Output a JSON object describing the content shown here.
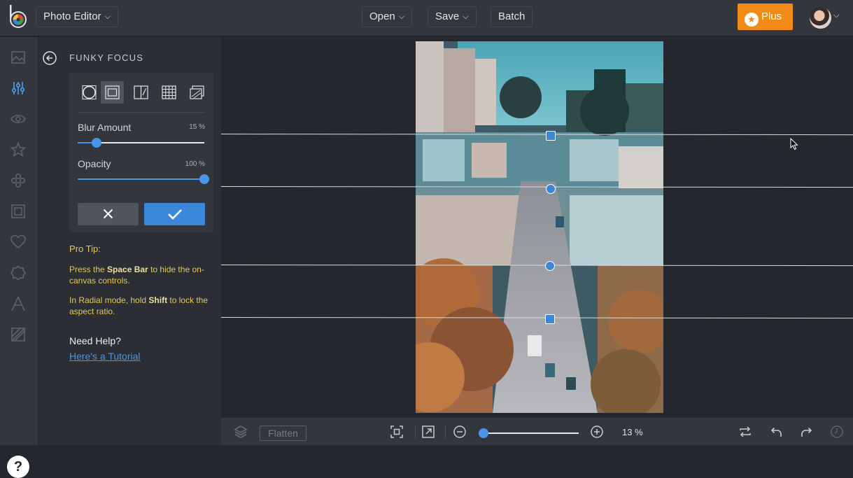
{
  "topbar": {
    "app_menu": "Photo Editor",
    "open": "Open",
    "save": "Save",
    "batch": "Batch",
    "plus": "Plus"
  },
  "panel": {
    "title": "FUNKY FOCUS",
    "blur_label": "Blur Amount",
    "blur_value": "15 %",
    "blur_level": 0.15,
    "opacity_label": "Opacity",
    "opacity_value": "100 %",
    "opacity_level": 1.0,
    "modes": [
      "radial",
      "linear",
      "mirror",
      "grid",
      "custom"
    ],
    "selected_mode": "linear"
  },
  "tips": {
    "heading": "Pro Tip:",
    "tip1_pre": "Press the ",
    "tip1_key": "Space Bar",
    "tip1_post": " to hide the on-canvas controls.",
    "tip2_pre": "In Radial mode, hold ",
    "tip2_key": "Shift",
    "tip2_post": " to lock the aspect ratio."
  },
  "help": {
    "heading": "Need Help?",
    "link": "Here's a Tutorial",
    "button": "?"
  },
  "bottombar": {
    "flatten": "Flatten",
    "zoom": "13 %",
    "zoom_level": 0.13
  },
  "colors": {
    "accent": "#4b95e6",
    "plus": "#f28a16",
    "tip": "#e6c94d"
  }
}
